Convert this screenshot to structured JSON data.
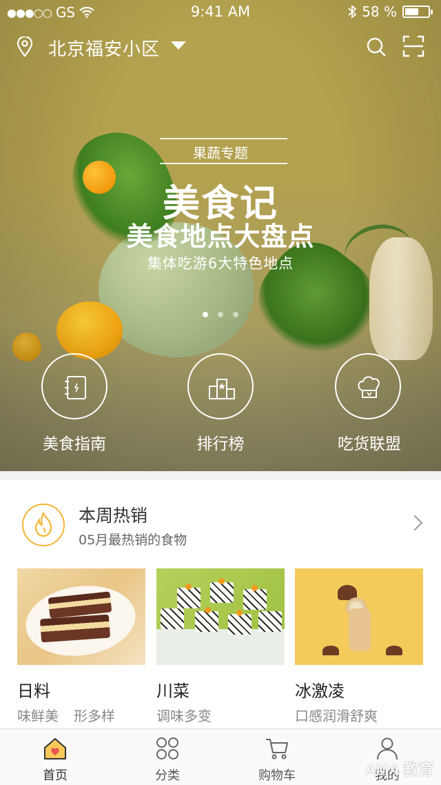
{
  "status_bar": {
    "carrier": "GS",
    "time": "9:41 AM",
    "battery_percent": "58 %",
    "battery_level": 0.58
  },
  "location": {
    "label": "北京福安小区"
  },
  "banner": {
    "tag": "果蔬专题",
    "title": "美食记",
    "subtitle": "美食地点大盘点",
    "description": "集体吃游6大特色地点",
    "pages": 3,
    "active_page": 1
  },
  "quick_entries": [
    {
      "label": "美食指南",
      "icon": "notebook-icon"
    },
    {
      "label": "排行榜",
      "icon": "ranking-icon"
    },
    {
      "label": "吃货联盟",
      "icon": "chef-hat-icon"
    }
  ],
  "hot": {
    "title": "本周热销",
    "subtitle": "05月最热销的食物",
    "accent_color": "#f5b433",
    "items": [
      {
        "name": "日料",
        "tags": [
          "味鲜美",
          "形多样"
        ]
      },
      {
        "name": "川菜",
        "tags": [
          "调味多变"
        ]
      },
      {
        "name": "冰激凌",
        "tags": [
          "口感润滑舒爽"
        ]
      }
    ]
  },
  "tabbar": {
    "items": [
      {
        "label": "首页",
        "icon": "home-icon",
        "active": true
      },
      {
        "label": "分类",
        "icon": "category-icon",
        "active": false
      },
      {
        "label": "购物车",
        "icon": "cart-icon",
        "active": false
      },
      {
        "label": "我的",
        "icon": "profile-icon",
        "active": false
      }
    ]
  },
  "watermark": "AMA 教育"
}
